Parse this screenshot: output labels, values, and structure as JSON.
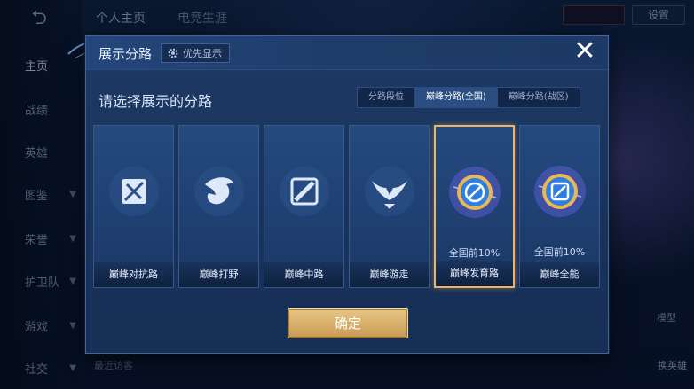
{
  "background": {
    "back_icon": "back-arrow-icon",
    "nav_items": [
      {
        "label": "主页",
        "active": true,
        "chevron": false
      },
      {
        "label": "战绩",
        "active": false,
        "chevron": false
      },
      {
        "label": "英雄",
        "active": false,
        "chevron": false
      },
      {
        "label": "图鉴",
        "active": false,
        "chevron": true
      },
      {
        "label": "荣誉",
        "active": false,
        "chevron": true
      },
      {
        "label": "护卫队",
        "active": false,
        "chevron": true
      },
      {
        "label": "游戏",
        "active": false,
        "chevron": true
      },
      {
        "label": "社交",
        "active": false,
        "chevron": true
      }
    ],
    "top_tabs": [
      "个人主页",
      "电竞生涯"
    ],
    "settings_label": "设置",
    "recent_visitors_label": "最近访客",
    "model_label": "模型",
    "switch_hero_label": "换英雄"
  },
  "modal": {
    "title": "展示分路",
    "priority_button_label": "优先显示",
    "close_icon": "close-icon",
    "subtitle": "请选择展示的分路",
    "segment_tabs": [
      {
        "label": "分路段位",
        "active": false
      },
      {
        "label": "巅峰分路(全国)",
        "active": true
      },
      {
        "label": "巅峰分路(战区)",
        "active": false
      }
    ],
    "cards": [
      {
        "label": "巅峰对抗路",
        "rank": "",
        "icon": "clash-lane-icon",
        "selected": false
      },
      {
        "label": "巅峰打野",
        "rank": "",
        "icon": "jungle-icon",
        "selected": false
      },
      {
        "label": "巅峰中路",
        "rank": "",
        "icon": "mid-lane-icon",
        "selected": false
      },
      {
        "label": "巅峰游走",
        "rank": "",
        "icon": "roam-icon",
        "selected": false
      },
      {
        "label": "巅峰发育路",
        "rank": "全国前10%",
        "icon": "farm-lane-badge-icon",
        "selected": true
      },
      {
        "label": "巅峰全能",
        "rank": "全国前10%",
        "icon": "all-round-badge-icon",
        "selected": false
      }
    ],
    "confirm_label": "确定"
  },
  "colors": {
    "modal_bg": "#1d3a66",
    "accent_gold": "#e9b56a",
    "active_tab": "#2a4d82"
  }
}
